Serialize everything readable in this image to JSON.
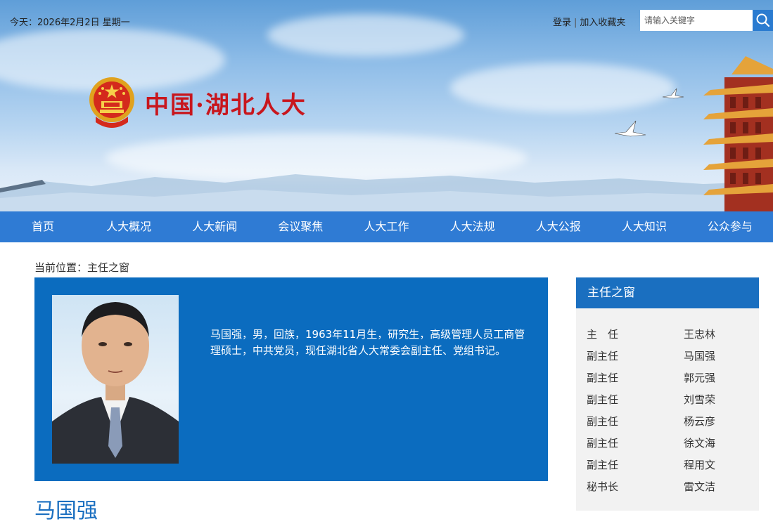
{
  "header": {
    "date_text": "今天：2026年2月2日 星期一",
    "login_label": "登录",
    "separator": "|",
    "favorite_label": "加入收藏夹",
    "search_placeholder": "请输入关键字",
    "site_title": "中国·湖北人大"
  },
  "nav": {
    "items": [
      "首页",
      "人大概况",
      "人大新闻",
      "会议聚焦",
      "人大工作",
      "人大法规",
      "人大公报",
      "人大知识",
      "公众参与"
    ]
  },
  "breadcrumb": "当前位置：主任之窗",
  "profile": {
    "bio": "马国强，男，回族，1963年11月生，研究生，高级管理人员工商管理硕士，中共党员，现任湖北省人大常委会副主任、党组书记。",
    "name": "马国强"
  },
  "sidebar": {
    "title": "主任之窗",
    "rows": [
      {
        "title": "主　任",
        "name": "王忠林"
      },
      {
        "title": "副主任",
        "name": "马国强"
      },
      {
        "title": "副主任",
        "name": "郭元强"
      },
      {
        "title": "副主任",
        "name": "刘雪荣"
      },
      {
        "title": "副主任",
        "name": "杨云彦"
      },
      {
        "title": "副主任",
        "name": "徐文海"
      },
      {
        "title": "副主任",
        "name": "程用文"
      },
      {
        "title": "秘书长",
        "name": "雷文洁"
      }
    ]
  },
  "colors": {
    "nav_blue": "#2f7bd4",
    "profile_blue": "#0b6cbf",
    "title_red": "#c8161d"
  }
}
